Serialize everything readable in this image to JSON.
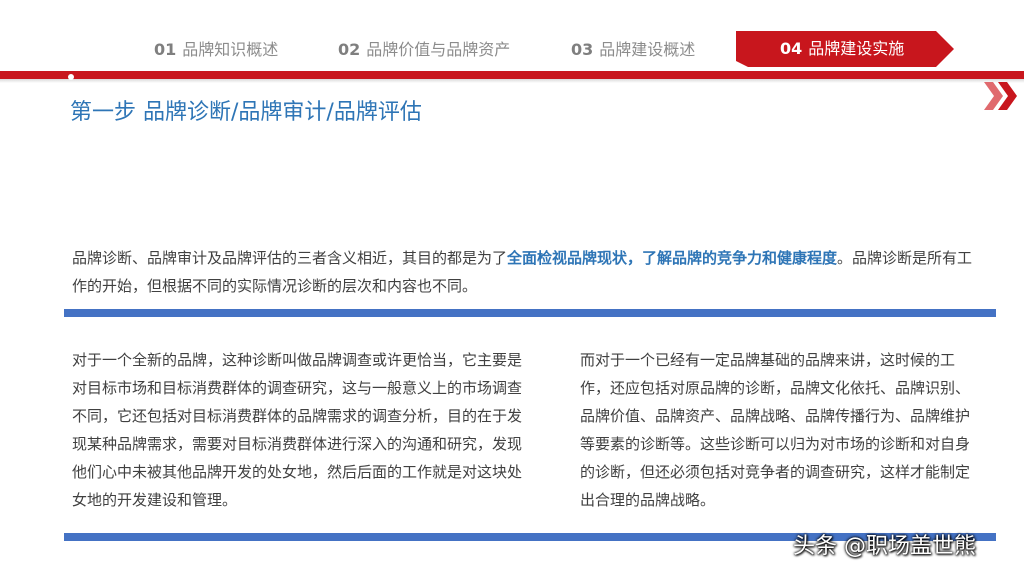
{
  "nav": {
    "items": [
      {
        "num": "01",
        "label": "品牌知识概述"
      },
      {
        "num": "02",
        "label": "品牌价值与品牌资产"
      },
      {
        "num": "03",
        "label": "品牌建设概述"
      }
    ],
    "active": {
      "num": "04",
      "label": "品牌建设实施"
    }
  },
  "colors": {
    "accent_red": "#c8161d",
    "title_blue": "#2e75b6",
    "bar_blue": "#4472c4",
    "body_text": "#404040"
  },
  "decor": {
    "chevron_icon": "double-chevron-right-icon"
  },
  "title": "第一步  品牌诊断/品牌审计/品牌评估",
  "intro": {
    "before": "品牌诊断、品牌审计及品牌评估的三者含义相近，其目的都是为了",
    "emphasis": "全面检视品牌现状，了解品牌的竞争力和健康程度",
    "after": "。品牌诊断是所有工作的开始，但根据不同的实际情况诊断的层次和内容也不同。"
  },
  "left_paragraph": "对于一个全新的品牌，这种诊断叫做品牌调查或许更恰当，它主要是对目标市场和目标消费群体的调查研究，这与一般意义上的市场调查不同，它还包括对目标消费群体的品牌需求的调查分析，目的在于发现某种品牌需求，需要对目标消费群体进行深入的沟通和研究，发现他们心中未被其他品牌开发的处女地，然后后面的工作就是对这块处女地的开发建设和管理。",
  "right_paragraph": "而对于一个已经有一定品牌基础的品牌来讲，这时候的工作，还应包括对原品牌的诊断，品牌文化依托、品牌识别、品牌价值、品牌资产、品牌战略、品牌传播行为、品牌维护等要素的诊断等。这些诊断可以归为对市场的诊断和对自身的诊断，但还必须包括对竞争者的调查研究，这样才能制定出合理的品牌战略。",
  "watermark": "头条 @职场盖世熊"
}
